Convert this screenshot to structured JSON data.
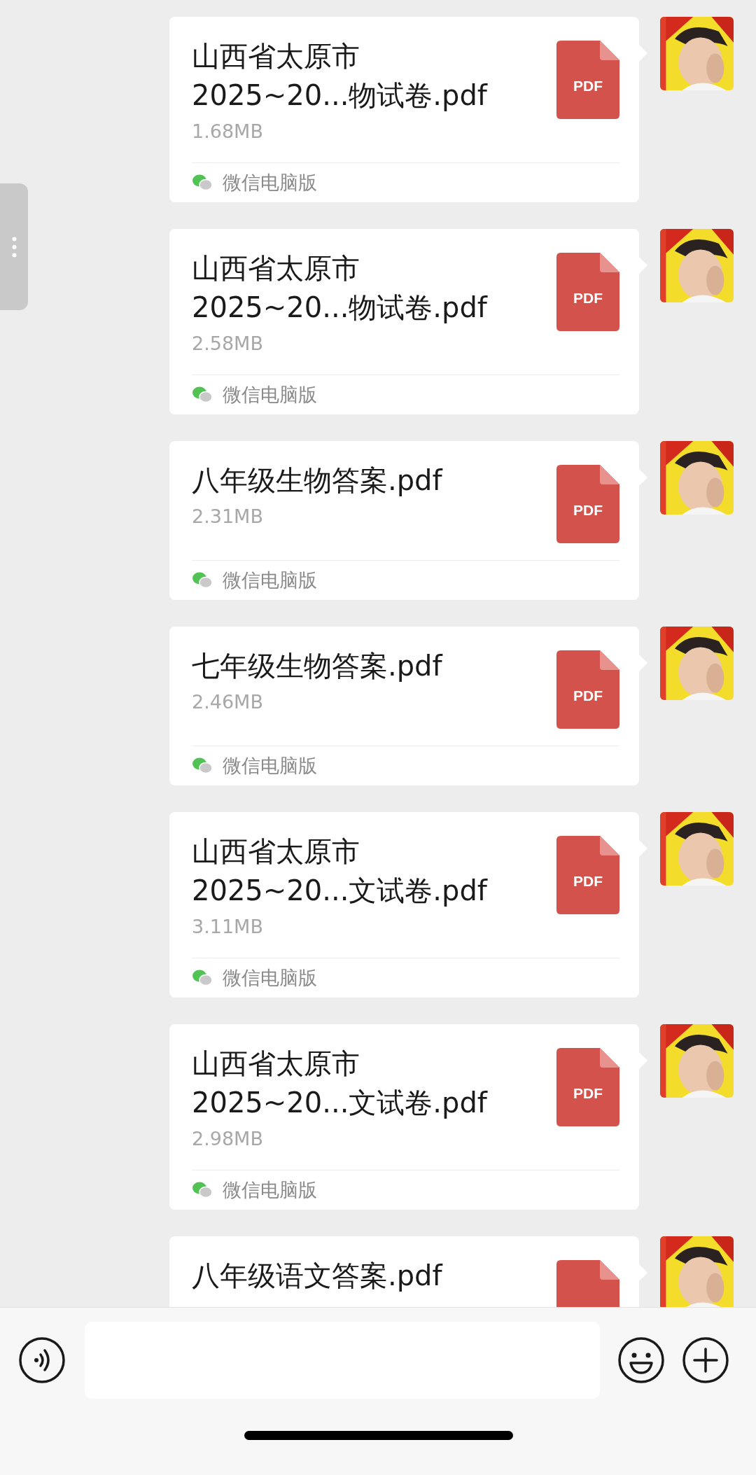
{
  "messages": [
    {
      "title_lines": [
        "山西省太原市",
        "2025~20...物试卷.pdf"
      ],
      "size": "1.68MB",
      "source": "微信电脑版",
      "file_badge": "PDF"
    },
    {
      "title_lines": [
        "山西省太原市",
        "2025~20...物试卷.pdf"
      ],
      "size": "2.58MB",
      "source": "微信电脑版",
      "file_badge": "PDF"
    },
    {
      "title_lines": [
        "八年级生物答案.pdf"
      ],
      "size": "2.31MB",
      "source": "微信电脑版",
      "file_badge": "PDF"
    },
    {
      "title_lines": [
        "七年级生物答案.pdf"
      ],
      "size": "2.46MB",
      "source": "微信电脑版",
      "file_badge": "PDF"
    },
    {
      "title_lines": [
        "山西省太原市",
        "2025~20...文试卷.pdf"
      ],
      "size": "3.11MB",
      "source": "微信电脑版",
      "file_badge": "PDF"
    },
    {
      "title_lines": [
        "山西省太原市",
        "2025~20...文试卷.pdf"
      ],
      "size": "2.98MB",
      "source": "微信电脑版",
      "file_badge": "PDF"
    },
    {
      "title_lines": [
        "八年级语文答案.pdf"
      ]
    }
  ]
}
